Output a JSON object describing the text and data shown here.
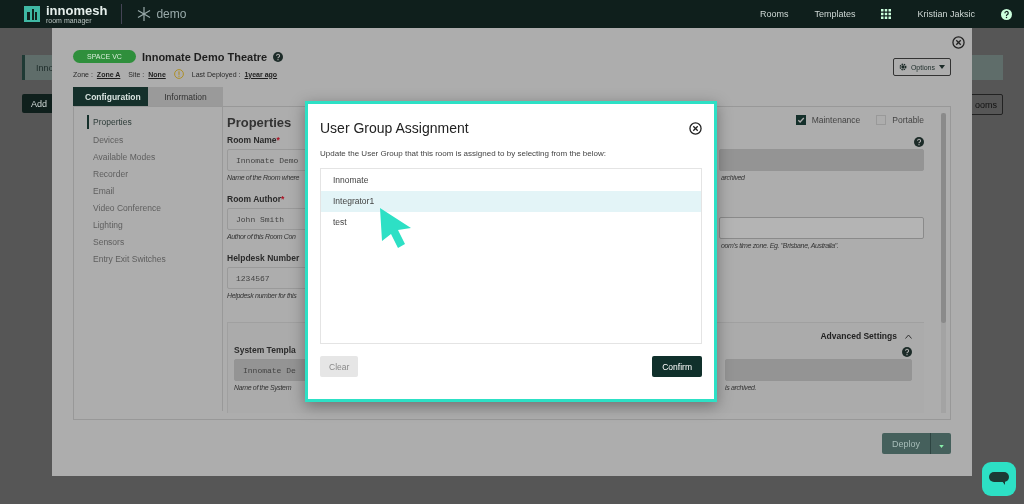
{
  "nav": {
    "brand": "innomesh",
    "brand_sub": "room manager",
    "tenant": "demo",
    "links": [
      {
        "label": "Rooms"
      },
      {
        "label": "Templates"
      }
    ],
    "user": "Kristian Jaksic"
  },
  "background": {
    "banner_text": "Inno",
    "add_button": "Add",
    "rooms_button": "ooms"
  },
  "room": {
    "badge": "SPACE VC",
    "title": "Innomate Demo Theatre",
    "zone_label": "Zone :",
    "zone": "Zone A",
    "site_label": "Site :",
    "site": "None",
    "deployed_label": "Last Deployed :",
    "deployed": "1year ago",
    "options": "Options"
  },
  "tabs": [
    {
      "label": "Configuration",
      "selected": true
    },
    {
      "label": "Information",
      "selected": false
    }
  ],
  "sidebar": {
    "items": [
      {
        "label": "Properties",
        "selected": true
      },
      {
        "label": "Devices",
        "selected": false
      },
      {
        "label": "Available Modes",
        "selected": false
      },
      {
        "label": "Recorder",
        "selected": false
      },
      {
        "label": "Email",
        "selected": false
      },
      {
        "label": "Video Conference",
        "selected": false
      },
      {
        "label": "Lighting",
        "selected": false
      },
      {
        "label": "Sensors",
        "selected": false
      },
      {
        "label": "Entry Exit Switches",
        "selected": false
      }
    ]
  },
  "properties": {
    "heading": "Properties",
    "flags": [
      {
        "label": "Maintenance",
        "checked": true
      },
      {
        "label": "Portable",
        "checked": false
      }
    ],
    "left_fields": [
      {
        "label": "Room Name",
        "required_mark": "*",
        "value": "Innomate Demo",
        "hint": "Name of the Room where"
      },
      {
        "label": "Room Author",
        "required_mark": "*",
        "value": "John Smith",
        "hint": "Author of this Room Con"
      },
      {
        "label": "Helpdesk Number",
        "value": "1234567",
        "hint": "Helpdesk number for this"
      }
    ],
    "right_fields": [
      {
        "disabled": true,
        "hint": "archived"
      },
      {
        "disabled": false,
        "hint": "oom's time zone. Eg. \"Brisbane, Australia\"."
      }
    ],
    "advanced": {
      "label": "Advanced Settings",
      "expanded": true,
      "left_field": {
        "label": "System Templa",
        "value": "Innomate De",
        "hint": "Name of the System"
      },
      "right_field": {
        "hint": "is archived."
      }
    }
  },
  "footer": {
    "deploy": "Deploy"
  },
  "dialog": {
    "title": "User Group Assignment",
    "description": "Update the User Group that this room is assigned to by selecting from the below:",
    "options": [
      {
        "label": "Innomate",
        "selected": false
      },
      {
        "label": "Integrator1",
        "selected": true
      },
      {
        "label": "test",
        "selected": false
      }
    ],
    "clear": {
      "label": "Clear",
      "disabled": true
    },
    "confirm": "Confirm"
  }
}
